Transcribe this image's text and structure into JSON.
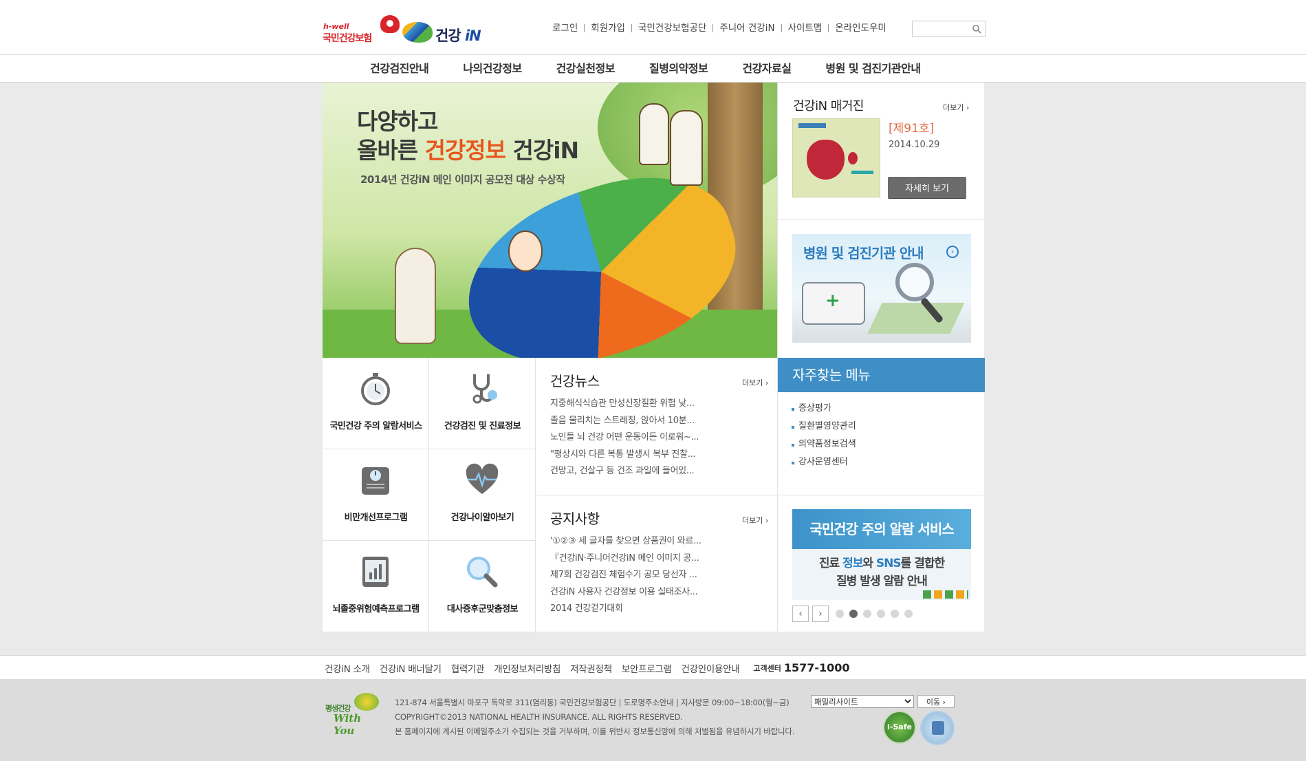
{
  "header": {
    "logo_nhis_en": "h-well",
    "logo_nhis_kr": "국민건강보험",
    "logo_gangin_kr": "건강",
    "logo_gangin_en": "iN",
    "links": [
      "로그인",
      "회원가입",
      "국민건강보험공단",
      "주니어 건강iN",
      "사이트맵",
      "온라인도우미"
    ],
    "search_placeholder": ""
  },
  "gnb": [
    "건강검진안내",
    "나의건강정보",
    "건강실천정보",
    "질병의약정보",
    "건강자료실",
    "병원 및 검진기관안내"
  ],
  "hero": {
    "line1": "다양하고",
    "line2_pre": "올바른 ",
    "line2_highlight": "건강정보",
    "line2_post": " 건강iN",
    "subtitle": "2014년 건강iN 메인 이미지 공모전 대상 수상작"
  },
  "magazine": {
    "title": "건강iN 매거진",
    "more": "더보기 ›",
    "issue": "[제91호]",
    "date": "2014.10.29",
    "button": "자세히 보기"
  },
  "hospital_banner": {
    "title": "병원 및 검진기관 안내",
    "arrow": "›"
  },
  "quick_menu": [
    {
      "label": "국민건강 주의 알람서비스",
      "icon": "stopwatch-icon"
    },
    {
      "label": "건강검진 및 진료정보",
      "icon": "stethoscope-icon"
    },
    {
      "label": "비만개선프로그램",
      "icon": "scale-icon"
    },
    {
      "label": "건강나이알아보기",
      "icon": "heartbeat-icon"
    },
    {
      "label": "뇌졸중위험예측프로그램",
      "icon": "tablet-chart-icon"
    },
    {
      "label": "대사증후군맞춤정보",
      "icon": "magnifier-icon"
    }
  ],
  "news": {
    "title": "건강뉴스",
    "more": "더보기 ›",
    "items": [
      "지중해식식습관 만성신장질환 위험 낮...",
      "졸음 물리치는 스트레칭, 앉아서 10분...",
      "노인들 뇌 건강 어떤 운동이든 이로워~...",
      "\"평상시와 다른 복통 발생시 복부 진찰...",
      "건망고, 건살구 등 건조 과일에 들어있..."
    ]
  },
  "notice": {
    "title": "공지사항",
    "more": "더보기 ›",
    "items": [
      "'①②③ 세 글자를 찾으면 상품권이 와르...",
      "『건강iN·주니어건강iN 메인 이미지 공...",
      "제7회 건강검진 체험수기 공모 당선자 ...",
      "건강iN 사용자 건강정보 이용 실태조사...",
      "2014 건강걷기대회"
    ]
  },
  "favorites": {
    "title": "자주찾는 메뉴",
    "items": [
      "증상평가",
      "질환별영양관리",
      "의약품정보검색",
      "강사운영센터"
    ]
  },
  "alarm_banner": {
    "title": "국민건강 주의 알람 서비스",
    "line1_pre": "진료 ",
    "line1_b1": "정보",
    "line1_mid": "와 ",
    "line1_b2": "SNS",
    "line1_post": "를 결합한",
    "line2": "질병 발생 알람 안내",
    "prev": "‹",
    "next": "›",
    "dots": 6,
    "active_dot": 1
  },
  "footer_links": {
    "items": [
      "건강iN 소개",
      "건강iN 배너달기",
      "협력기관",
      "개인정보처리방침",
      "저작권정책",
      "보안프로그램",
      "건강인이용안내"
    ],
    "cs_label": "고객센터",
    "cs_tel": "1577-1000"
  },
  "footer": {
    "logo_line1": "평생건강",
    "logo_line2": "With You",
    "address": "121-874 서울특별시 마포구 독막로 311(염리동) 국민건강보험공단 | 도로명주소안내 | 지사방문 09:00~18:00(월~금)",
    "copyright": "COPYRIGHT©2013 NATIONAL HEALTH INSURANCE. ALL RIGHTS RESERVED.",
    "notice": "본 홈페이지에 게시된 이메일주소가 수집되는 것을 거부하며, 이를 위반시 정보통신망에 의해 처벌됨을 유념하시기 바랍니다.",
    "family_site": "패밀리사이트",
    "go_button": "이동 ›",
    "mark1": "i-Safe"
  }
}
